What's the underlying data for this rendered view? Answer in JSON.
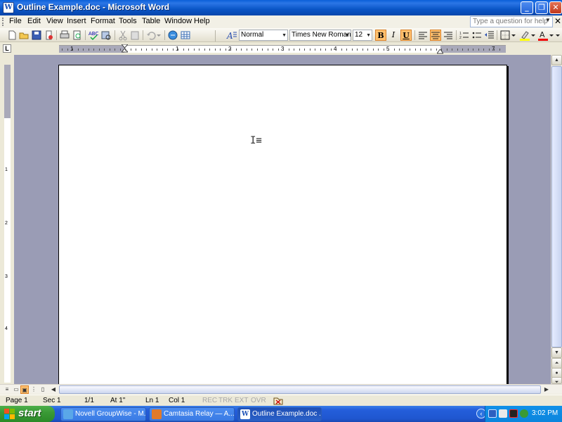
{
  "window": {
    "title": "Outline Example.doc - Microsoft Word",
    "minimize": "_",
    "maximize": "❐",
    "close": "✕"
  },
  "menubar": {
    "items": [
      "File",
      "Edit",
      "View",
      "Insert",
      "Format",
      "Tools",
      "Table",
      "Window",
      "Help"
    ],
    "help_placeholder": "Type a question for help",
    "doc_close": "✕"
  },
  "toolbar": {
    "style": "Normal",
    "font": "Times New Roman",
    "size": "12",
    "bold": "B",
    "italic": "I",
    "underline": "U"
  },
  "ruler": {
    "tab_selector": "L",
    "h_numbers": [
      "1",
      "1",
      "2",
      "3",
      "4",
      "5",
      "7"
    ],
    "v_numbers": [
      "1",
      "2",
      "3",
      "4"
    ]
  },
  "statusbar": {
    "page": "Page 1",
    "sec": "Sec 1",
    "pages": "1/1",
    "at": "At 1\"",
    "ln": "Ln 1",
    "col": "Col 1",
    "rec": "REC",
    "trk": "TRK",
    "ext": "EXT",
    "ovr": "OVR"
  },
  "taskbar": {
    "start": "start",
    "tasks": [
      {
        "label": "Novell GroupWise - M...",
        "active": false
      },
      {
        "label": "Camtasia Relay — A...",
        "active": false
      },
      {
        "label": "Outline Example.doc ...",
        "active": true
      }
    ],
    "clock": "3:02 PM"
  },
  "colors": {
    "titlebar": "#0a55c6",
    "workspace": "#9a9cb5",
    "active_button": "#ffc06e"
  }
}
